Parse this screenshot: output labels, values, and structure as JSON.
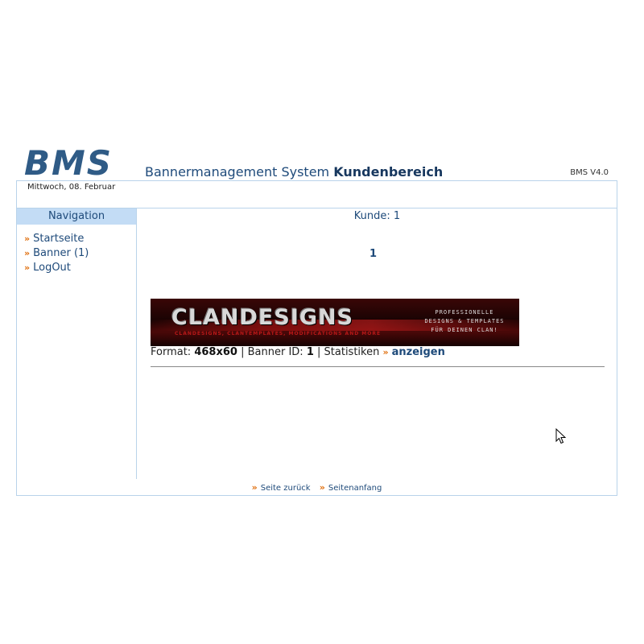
{
  "header": {
    "logo": "BMS",
    "title_regular": "Bannermanagement System",
    "title_bold": "Kundenbereich",
    "version": "BMS V4.0",
    "date": "Mittwoch, 08. Februar"
  },
  "sidebar": {
    "heading": "Navigation",
    "items": [
      {
        "label": "Startseite"
      },
      {
        "label": "Banner (1)"
      },
      {
        "label": "LogOut"
      }
    ]
  },
  "main": {
    "kunde": "Kunde: 1",
    "page_number": "1",
    "banner": {
      "main_text": "CLANDESIGNS",
      "sub_text": "CLANDESIGNS, CLANTEMPLATES, MODIFICATIONS AND MORE",
      "right_line1": "PROFESSIONELLE",
      "right_line2": "DESIGNS & TEMPLATES",
      "right_line3": "FÜR DEINEN CLAN!"
    },
    "info": {
      "format_label": "Format:",
      "format_value": "468x60",
      "id_label": "Banner ID:",
      "id_value": "1",
      "stats_label": "Statistiken",
      "stats_link": "anzeigen"
    }
  },
  "footer": {
    "back": "Seite zurück",
    "top": "Seitenanfang"
  },
  "colors": {
    "accent_arrow": "#e07010",
    "nav_header_bg": "#c3dcf5",
    "border": "#b9d3ea",
    "text_blue": "#1e4a7a"
  }
}
